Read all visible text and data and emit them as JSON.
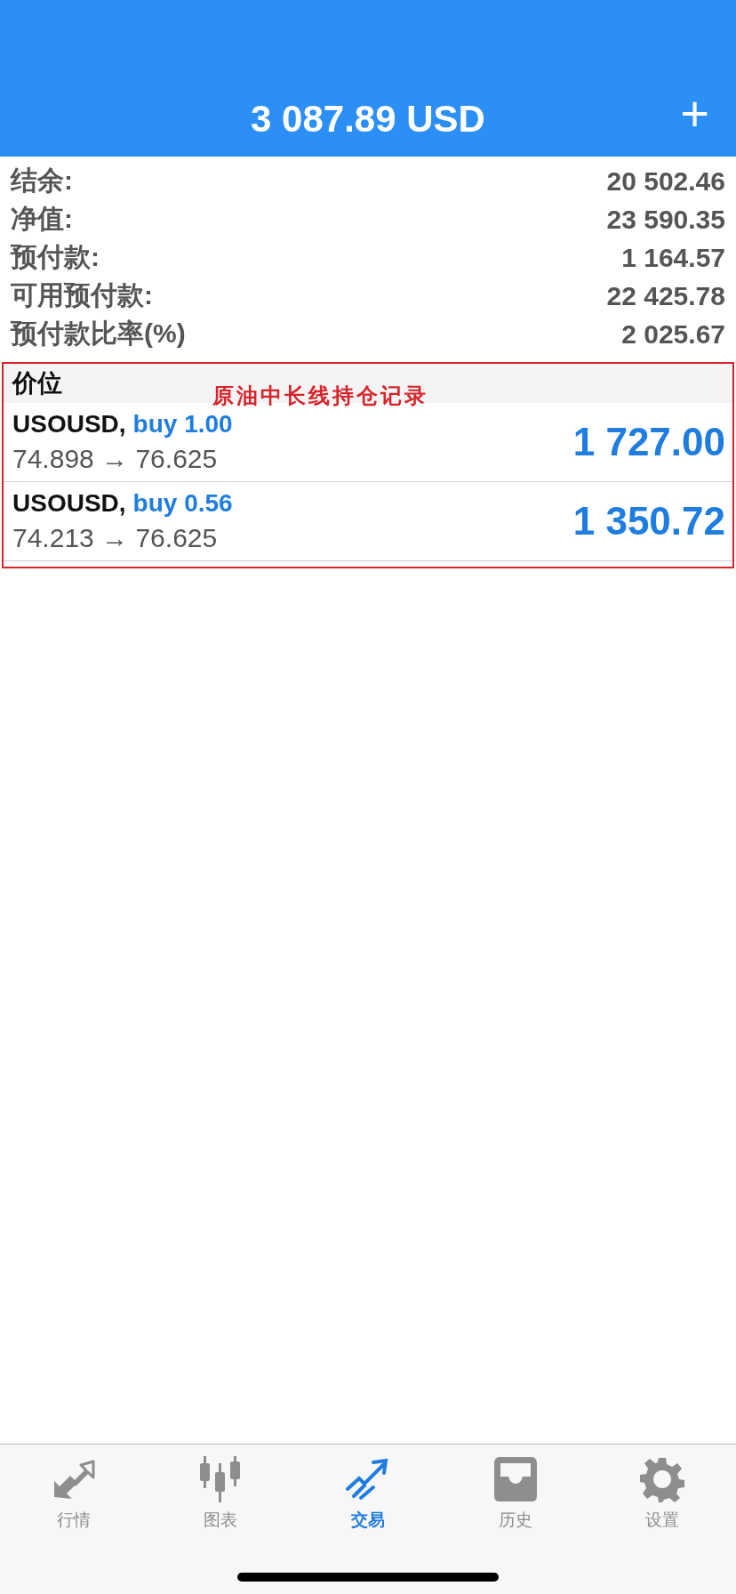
{
  "header": {
    "title": "3 087.89 USD",
    "add_button": "+"
  },
  "summary": [
    {
      "label": "结余:",
      "value": "20 502.46"
    },
    {
      "label": "净值:",
      "value": "23 590.35"
    },
    {
      "label": "预付款:",
      "value": "1 164.57"
    },
    {
      "label": "可用预付款:",
      "value": "22 425.78"
    },
    {
      "label": "预付款比率(%)",
      "value": "2 025.67"
    }
  ],
  "positions": {
    "heading": "价位",
    "annotation": "原油中长线持仓记录",
    "rows": [
      {
        "symbol": "USOUSD,",
        "order": "buy 1.00",
        "prices": "74.898 → 76.625",
        "profit": "1 727.00"
      },
      {
        "symbol": "USOUSD,",
        "order": "buy 0.56",
        "prices": "74.213 → 76.625",
        "profit": "1 350.72"
      }
    ]
  },
  "tab_bar": [
    {
      "kind": "quotes",
      "label": "行情",
      "selected": false
    },
    {
      "kind": "chart",
      "label": "图表",
      "selected": false
    },
    {
      "kind": "trade",
      "label": "交易",
      "selected": true
    },
    {
      "kind": "history",
      "label": "历史",
      "selected": false
    },
    {
      "kind": "settings",
      "label": "设置",
      "selected": false
    }
  ]
}
